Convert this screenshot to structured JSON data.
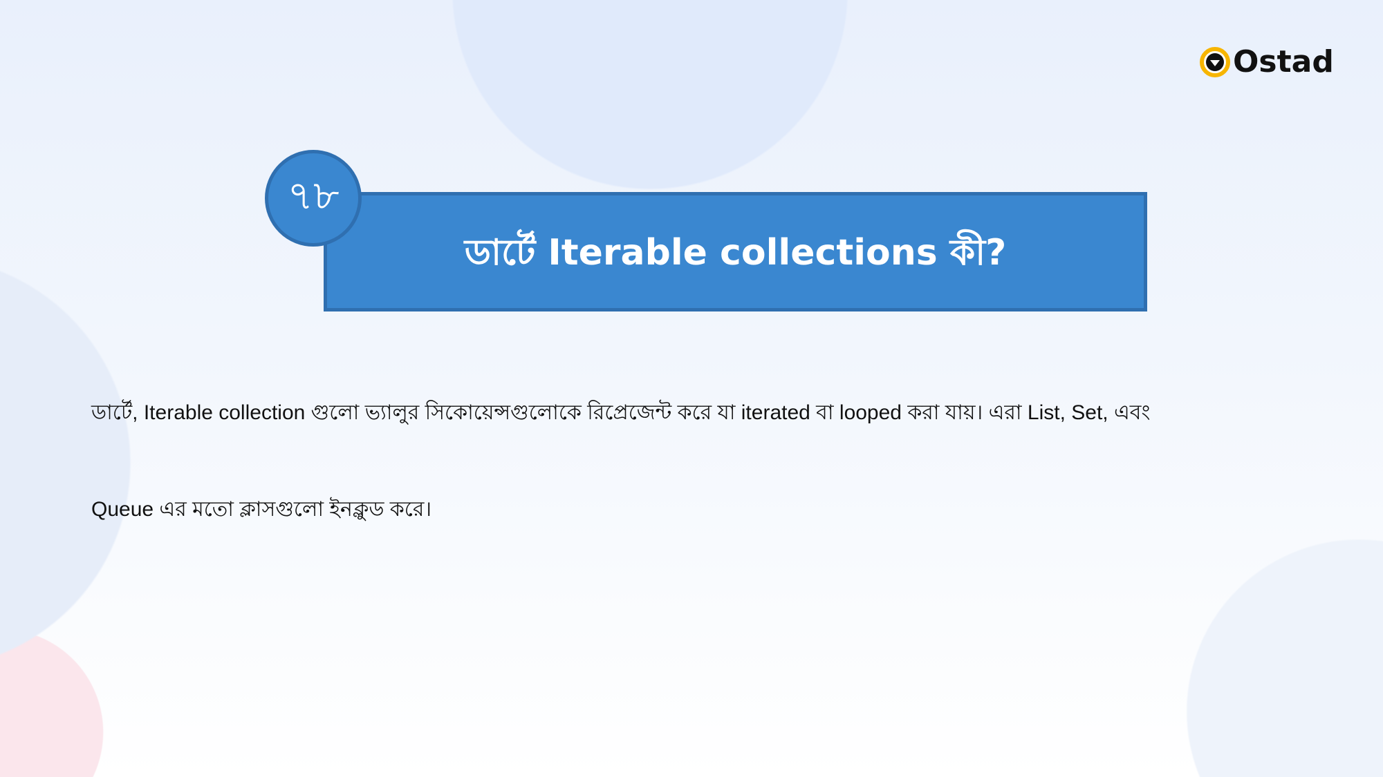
{
  "logo": {
    "text": "Ostad"
  },
  "slide": {
    "number": "৭৮",
    "title": "ডার্টে Iterable collections কী?",
    "body_lines": [
      "ডার্টে, Iterable collection গুলো ভ্যালুর সিকোয়েন্সগুলোকে রিপ্রেজেন্ট করে যা iterated বা looped করা যায়। এরা List, Set, এবং",
      "Queue এর মতো ক্লাসগুলো ইনক্লুড করে।"
    ]
  },
  "colors": {
    "accent": "#3a87d0",
    "accent_border": "#2f6fb0",
    "logo_ring": "#f7b500"
  }
}
